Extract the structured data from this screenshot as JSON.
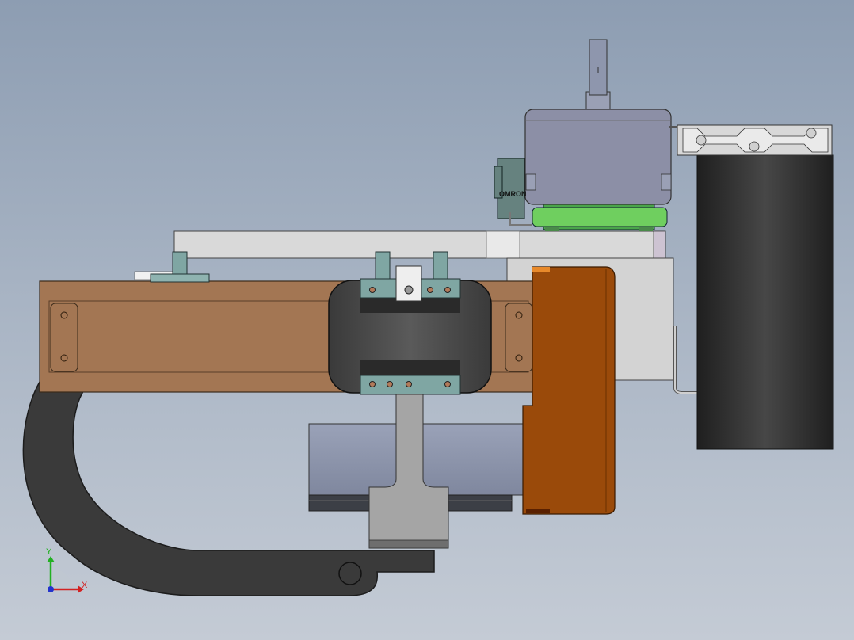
{
  "scene": {
    "background_top": "#8d9db2",
    "background_bottom": "#c4cbd5",
    "colors": {
      "wood_arm": "#a37653",
      "orange_housing": "#9a4a0a",
      "black_tire": "#2e2e2e",
      "grey_base": "#cfcfcf",
      "motor_body": "#8c8fa6",
      "green_plate": "#6fcf5f",
      "rail": "#d8d8d8",
      "teal_clamp": "#7fa6a3"
    }
  },
  "labels": {
    "sensor_brand": "OMRON"
  },
  "triad": {
    "x_label": "X",
    "y_label": "Y",
    "x_color": "#d22222",
    "y_color": "#22b022",
    "z_color": "#2233cc"
  }
}
